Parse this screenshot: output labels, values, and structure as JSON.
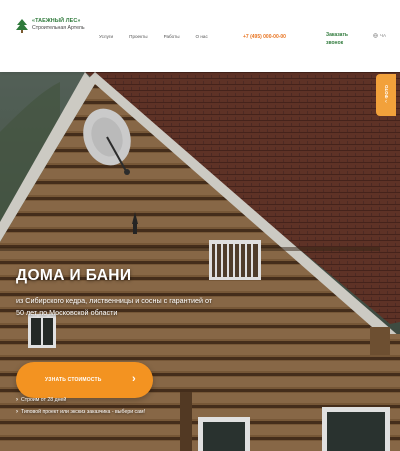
{
  "header": {
    "logo": {
      "name": "«ТАЕЖНЫЙ ЛЕС»",
      "subtitle": "Строительная Артель"
    },
    "nav": [
      {
        "label": "Услуги"
      },
      {
        "label": "Проекты"
      },
      {
        "label": "Работы"
      },
      {
        "label": "О нас"
      }
    ],
    "phone": "+7 (495) 000-00-00",
    "callback": "Заказать звонок",
    "lang": "ЧА"
  },
  "side_tab": {
    "label": "ФОТО"
  },
  "hero": {
    "title": "ДОМА И БАНИ",
    "subtitle": "из Сибирского кедра, лиственницы и сосны с гарантией от 50 лет по Московской области",
    "cta": "УЗНАТЬ СТОИМОСТЬ",
    "features": [
      {
        "text": "Строим от 28 дней"
      },
      {
        "text": "Типовой проект или экскиз заказчика - выбери сам!"
      }
    ]
  },
  "colors": {
    "accent": "#f39321",
    "brand": "#2f7a3b",
    "phone": "#e8731f"
  }
}
